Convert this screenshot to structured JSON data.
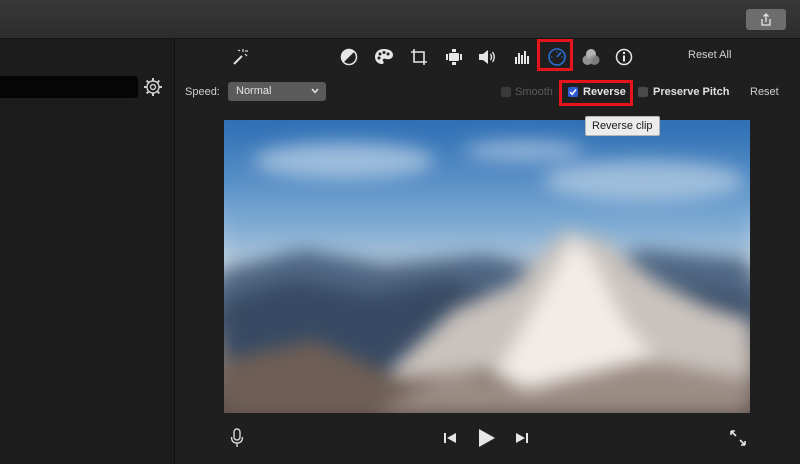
{
  "window": {
    "share_icon": "share-icon"
  },
  "left_pane": {
    "search_value": "",
    "settings_icon": "gear-icon"
  },
  "toolbar": {
    "tools": [
      {
        "name": "magic-wand-icon"
      },
      {
        "name": "color-balance-icon"
      },
      {
        "name": "color-correction-icon"
      },
      {
        "name": "crop-icon"
      },
      {
        "name": "stabilization-icon"
      },
      {
        "name": "volume-icon"
      },
      {
        "name": "noise-reduction-icon"
      },
      {
        "name": "speed-icon",
        "active": true
      },
      {
        "name": "clip-filter-icon"
      },
      {
        "name": "info-icon"
      }
    ],
    "reset_all_label": "Reset All"
  },
  "speed_controls": {
    "speed_label": "Speed:",
    "speed_value": "Normal",
    "smooth_label": "Smooth",
    "smooth_checked": false,
    "reverse_label": "Reverse",
    "reverse_checked": true,
    "preserve_pitch_label": "Preserve Pitch",
    "preserve_pitch_checked": false,
    "reset_label": "Reset",
    "tooltip": "Reverse clip"
  },
  "playback": {
    "mic_icon": "microphone-icon",
    "prev_icon": "skip-back-icon",
    "play_icon": "play-icon",
    "next_icon": "skip-forward-icon",
    "fullscreen_icon": "fullscreen-icon"
  },
  "colors": {
    "highlight": "#e8141b",
    "accent": "#2f5bd3",
    "active_tool": "#2a6fd6"
  }
}
